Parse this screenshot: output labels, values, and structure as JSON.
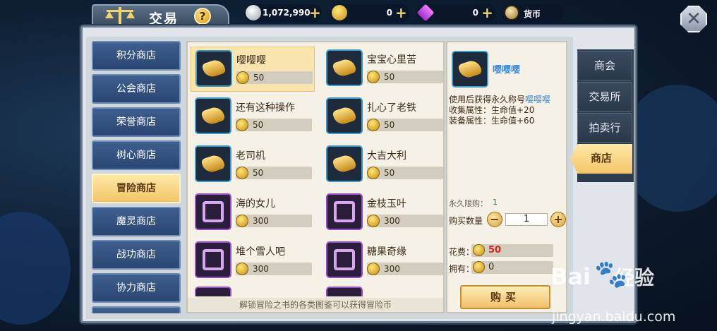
{
  "header": {
    "title": "交易",
    "help_label": "?",
    "close_label": "✕"
  },
  "currencies": [
    {
      "icon": "silver-coin-icon",
      "value": "1,072,990"
    },
    {
      "icon": "gold-coin-icon",
      "value": "0"
    },
    {
      "icon": "purple-gem-icon",
      "value": "0"
    },
    {
      "icon": "token-icon",
      "value": "货币"
    }
  ],
  "sidebar": {
    "items": [
      {
        "label": "积分商店"
      },
      {
        "label": "公会商店"
      },
      {
        "label": "荣誉商店"
      },
      {
        "label": "树心商店"
      },
      {
        "label": "冒险商店",
        "active": true
      },
      {
        "label": "魔灵商店"
      },
      {
        "label": "战功商店"
      },
      {
        "label": "协力商店"
      }
    ]
  },
  "shop": {
    "items": [
      {
        "name": "嘤嘤嘤",
        "price": "50",
        "icon": "title-badge-icon",
        "frame": "blue",
        "selected": true
      },
      {
        "name": "宝宝心里苦",
        "price": "50",
        "icon": "title-badge-icon",
        "frame": "blue"
      },
      {
        "name": "还有这种操作",
        "price": "50",
        "icon": "title-badge-icon",
        "frame": "blue"
      },
      {
        "name": "扎心了老铁",
        "price": "50",
        "icon": "title-badge-icon",
        "frame": "blue"
      },
      {
        "name": "老司机",
        "price": "50",
        "icon": "title-badge-icon",
        "frame": "blue"
      },
      {
        "name": "大吉大利",
        "price": "50",
        "icon": "title-badge-icon",
        "frame": "blue"
      },
      {
        "name": "海的女儿",
        "price": "300",
        "icon": "avatar-frame-icon",
        "frame": "purple"
      },
      {
        "name": "金枝玉叶",
        "price": "300",
        "icon": "avatar-frame-icon",
        "frame": "purple"
      },
      {
        "name": "堆个雪人吧",
        "price": "300",
        "icon": "avatar-frame-icon",
        "frame": "purple"
      },
      {
        "name": "糖果奇缘",
        "price": "300",
        "icon": "avatar-frame-icon",
        "frame": "purple"
      }
    ],
    "footer": "解锁冒险之书的各类图鉴可以获得冒险币"
  },
  "detail": {
    "name": "嘤嘤嘤",
    "desc_prefix": "使用后获得永久称号",
    "desc_highlight": "嘤嘤嘤",
    "attr_collect": "收集属性：生命值+20",
    "attr_equip": "装备属性：生命值+60",
    "limit_label": "永久限购：",
    "limit_value": "1",
    "qty_label": "购买数量",
    "qty_minus": "−",
    "qty_value": "1",
    "qty_plus": "+",
    "cost_label": "花费：",
    "cost_value": "50",
    "own_label": "拥有：",
    "own_value": "0",
    "buy_label": "购买"
  },
  "right_tabs": [
    {
      "label": "商会"
    },
    {
      "label": "交易所"
    },
    {
      "label": "拍卖行"
    },
    {
      "label": "商店",
      "active": true
    }
  ],
  "watermark": {
    "logo": "Bai",
    "logo_cn": "经验",
    "url": "jingyan.baidu.com"
  },
  "colors": {
    "accent_gold": "#f3c567",
    "highlight_blue": "#3f8ed8",
    "cost_red": "#d42020"
  }
}
